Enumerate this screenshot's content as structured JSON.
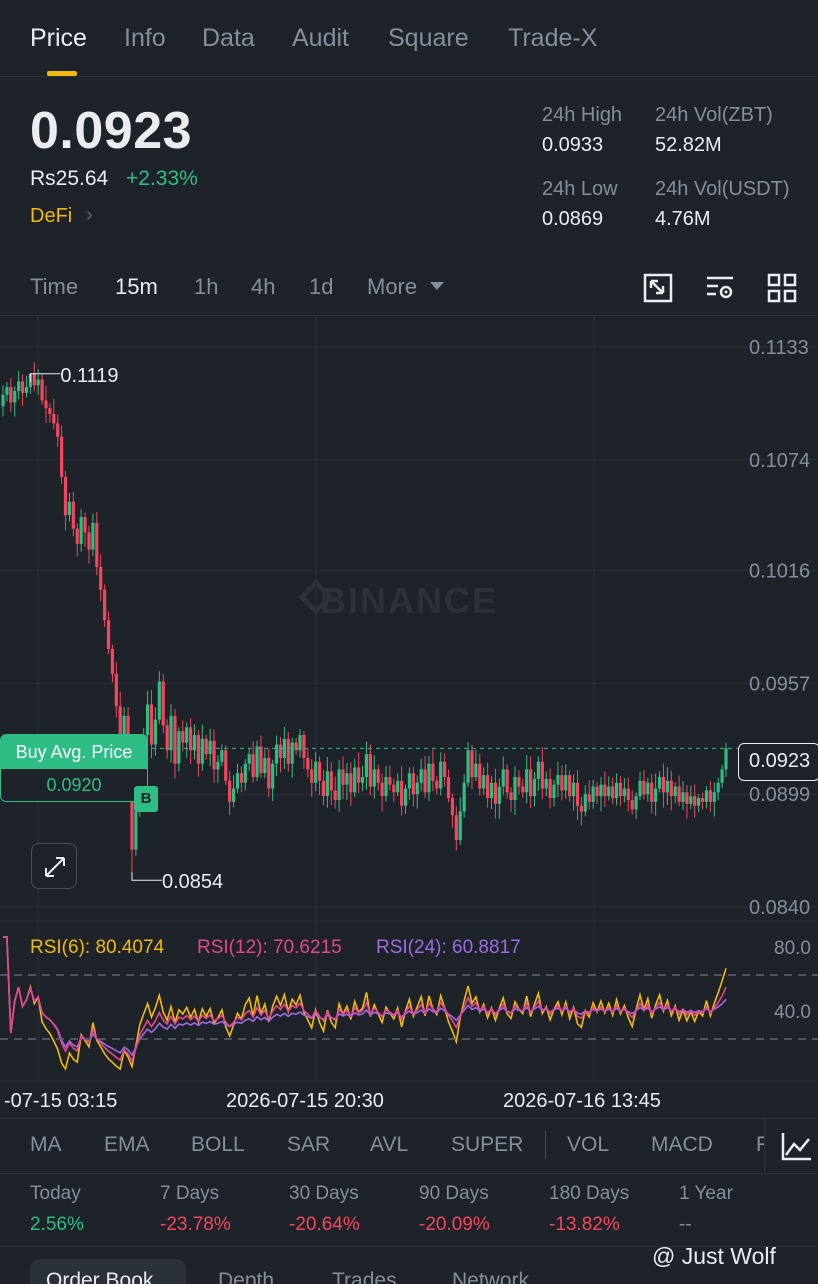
{
  "tabs": [
    {
      "label": "Price",
      "active": true
    },
    {
      "label": "Info",
      "active": false
    },
    {
      "label": "Data",
      "active": false
    },
    {
      "label": "Audit",
      "active": false
    },
    {
      "label": "Square",
      "active": false
    },
    {
      "label": "Trade-X",
      "active": false
    }
  ],
  "ticker": {
    "price": "0.0923",
    "fiat_price": "Rs25.64",
    "change": "+2.33%",
    "category": "DeFi"
  },
  "stats": {
    "high_label": "24h High",
    "high_value": "0.0933",
    "vol_base_label": "24h Vol(ZBT)",
    "vol_base_value": "52.82M",
    "low_label": "24h Low",
    "low_value": "0.0869",
    "vol_quote_label": "24h Vol(USDT)",
    "vol_quote_value": "4.76M"
  },
  "intervals": [
    {
      "label": "Time",
      "active": false
    },
    {
      "label": "15m",
      "active": true
    },
    {
      "label": "1h",
      "active": false
    },
    {
      "label": "4h",
      "active": false
    },
    {
      "label": "1d",
      "active": false
    },
    {
      "label": "More",
      "active": false
    }
  ],
  "chart_data": {
    "type": "candlestick",
    "watermark": "BINANCE",
    "y_ticks": [
      "0.1133",
      "0.1074",
      "0.1016",
      "0.0957",
      "0.0899",
      "0.0840"
    ],
    "ylim": [
      0.084,
      0.1133
    ],
    "x_ticks": [
      "-07-15 03:15",
      "2026-07-15 20:30",
      "2026-07-16 13:45"
    ],
    "high_marker": "0.1119",
    "low_marker": "0.0854",
    "current_price": "0.0923",
    "buy_avg_label": "Buy Avg. Price",
    "buy_avg_value": "0.0920",
    "buy_badge": "B",
    "close": [
      0.1108,
      0.1112,
      0.1104,
      0.111,
      0.1115,
      0.1109,
      0.1112,
      0.1119,
      0.1113,
      0.1116,
      0.1105,
      0.1101,
      0.1098,
      0.1093,
      0.1086,
      0.1065,
      0.1045,
      0.1052,
      0.1038,
      0.103,
      0.1044,
      0.1036,
      0.1027,
      0.1041,
      0.1018,
      0.1006,
      0.099,
      0.0975,
      0.0962,
      0.0945,
      0.0928,
      0.094,
      0.092,
      0.087,
      0.089,
      0.0915,
      0.093,
      0.0946,
      0.0925,
      0.0938,
      0.0958,
      0.0935,
      0.0922,
      0.094,
      0.0915,
      0.0932,
      0.0926,
      0.0934,
      0.0922,
      0.093,
      0.0915,
      0.0928,
      0.092,
      0.0927,
      0.0912,
      0.0916,
      0.0922,
      0.0906,
      0.0895,
      0.0902,
      0.091,
      0.0905,
      0.0915,
      0.092,
      0.0908,
      0.0924,
      0.091,
      0.0918,
      0.0902,
      0.0915,
      0.0925,
      0.0918,
      0.0928,
      0.0915,
      0.0926,
      0.0922,
      0.093,
      0.0918,
      0.0912,
      0.0905,
      0.0916,
      0.0906,
      0.0898,
      0.0911,
      0.0901,
      0.0896,
      0.0912,
      0.0904,
      0.091,
      0.09,
      0.0913,
      0.0905,
      0.0908,
      0.092,
      0.0903,
      0.0912,
      0.0905,
      0.0898,
      0.0908,
      0.0904,
      0.09,
      0.0906,
      0.0893,
      0.0902,
      0.091,
      0.0899,
      0.0905,
      0.0912,
      0.09,
      0.0915,
      0.0906,
      0.0902,
      0.0916,
      0.0908,
      0.0897,
      0.0888,
      0.0875,
      0.089,
      0.0905,
      0.0922,
      0.0908,
      0.0915,
      0.0902,
      0.0909,
      0.0897,
      0.0905,
      0.0894,
      0.0903,
      0.0912,
      0.09,
      0.0896,
      0.0908,
      0.0903,
      0.09,
      0.0912,
      0.0898,
      0.0907,
      0.0916,
      0.0902,
      0.0907,
      0.0897,
      0.0904,
      0.0909,
      0.0901,
      0.0909,
      0.0898,
      0.0905,
      0.0893,
      0.089,
      0.0899,
      0.0895,
      0.0903,
      0.0898,
      0.0904,
      0.0898,
      0.0903,
      0.0897,
      0.0905,
      0.0898,
      0.0902,
      0.0896,
      0.0891,
      0.0898,
      0.0906,
      0.0899,
      0.0905,
      0.0895,
      0.0902,
      0.0908,
      0.09,
      0.0906,
      0.0898,
      0.0903,
      0.0895,
      0.09,
      0.0894,
      0.0898,
      0.0893,
      0.0897,
      0.0895,
      0.0901,
      0.0895,
      0.09,
      0.0905,
      0.0912,
      0.0923
    ],
    "rsi": {
      "rsi6": {
        "label": "RSI(6): 80.4074",
        "color": "#f0b90b"
      },
      "rsi12": {
        "label": "RSI(12): 70.6215",
        "color": "#e6458f"
      },
      "rsi24": {
        "label": "RSI(24): 60.8817",
        "color": "#9b6be3"
      },
      "y_ticks": [
        "80.0",
        "40.0"
      ],
      "ylim": [
        0,
        100
      ]
    }
  },
  "indicators": [
    "MA",
    "EMA",
    "BOLL",
    "SAR",
    "AVL",
    "SUPER",
    "VOL",
    "MACD",
    "RSI"
  ],
  "performance": [
    {
      "label": "Today",
      "value": "2.56%",
      "dir": "up"
    },
    {
      "label": "7 Days",
      "value": "-23.78%",
      "dir": "down"
    },
    {
      "label": "30 Days",
      "value": "-20.64%",
      "dir": "down"
    },
    {
      "label": "90 Days",
      "value": "-20.09%",
      "dir": "down"
    },
    {
      "label": "180 Days",
      "value": "-13.82%",
      "dir": "down"
    },
    {
      "label": "1 Year",
      "value": "--",
      "dir": "none"
    }
  ],
  "bottom_tabs": [
    "Order Book",
    "Depth",
    "Trades",
    "Network"
  ],
  "credit": "@ Just Wolf",
  "colors": {
    "up": "#2ebd85",
    "down": "#f6465d",
    "accent": "#f0b90b",
    "bg": "#1e2329"
  }
}
